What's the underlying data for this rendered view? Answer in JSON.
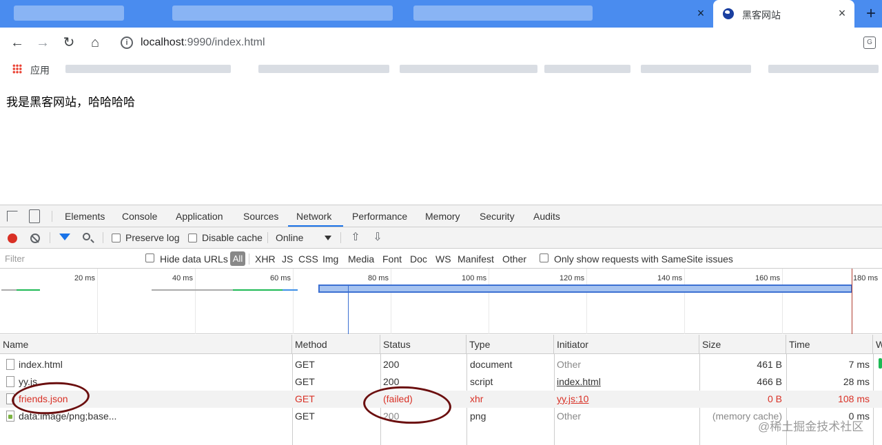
{
  "browser": {
    "active_tab_title": "黑客网站",
    "tab_close": "×",
    "new_tab": "+",
    "url_host": "localhost",
    "url_rest": ":9990/index.html",
    "bookmarks_apps_label": "应用"
  },
  "page": {
    "body_text": "我是黑客网站，哈哈哈哈"
  },
  "devtools": {
    "tabs": [
      "Elements",
      "Console",
      "Application",
      "Sources",
      "Network",
      "Performance",
      "Memory",
      "Security",
      "Audits"
    ],
    "active_tab": "Network",
    "toolbar": {
      "preserve_log": "Preserve log",
      "disable_cache": "Disable cache",
      "throttling": "Online"
    },
    "filter": {
      "placeholder": "Filter",
      "hide_data_urls": "Hide data URLs",
      "all": "All",
      "types": [
        "XHR",
        "JS",
        "CSS",
        "Img",
        "Media",
        "Font",
        "Doc",
        "WS",
        "Manifest",
        "Other"
      ],
      "samesite": "Only show requests with SameSite issues"
    },
    "overview_ticks": [
      "20 ms",
      "40 ms",
      "60 ms",
      "80 ms",
      "100 ms",
      "120 ms",
      "140 ms",
      "160 ms",
      "180 ms"
    ],
    "columns": [
      "Name",
      "Method",
      "Status",
      "Type",
      "Initiator",
      "Size",
      "Time",
      "W"
    ],
    "rows": [
      {
        "name": "index.html",
        "method": "GET",
        "status": "200",
        "type": "document",
        "initiator": "Other",
        "size": "461 B",
        "time": "7 ms"
      },
      {
        "name": "yy.js",
        "method": "GET",
        "status": "200",
        "type": "script",
        "initiator": "index.html",
        "size": "466 B",
        "time": "28 ms"
      },
      {
        "name": "friends.json",
        "method": "GET",
        "status": "(failed)",
        "type": "xhr",
        "initiator": "yy.js:10",
        "size": "0 B",
        "time": "108 ms"
      },
      {
        "name": "data:image/png;base...",
        "method": "GET",
        "status": "200",
        "type": "png",
        "initiator": "Other",
        "size": "(memory cache)",
        "time": "0 ms"
      }
    ]
  },
  "watermark": "@稀土掘金技术社区"
}
